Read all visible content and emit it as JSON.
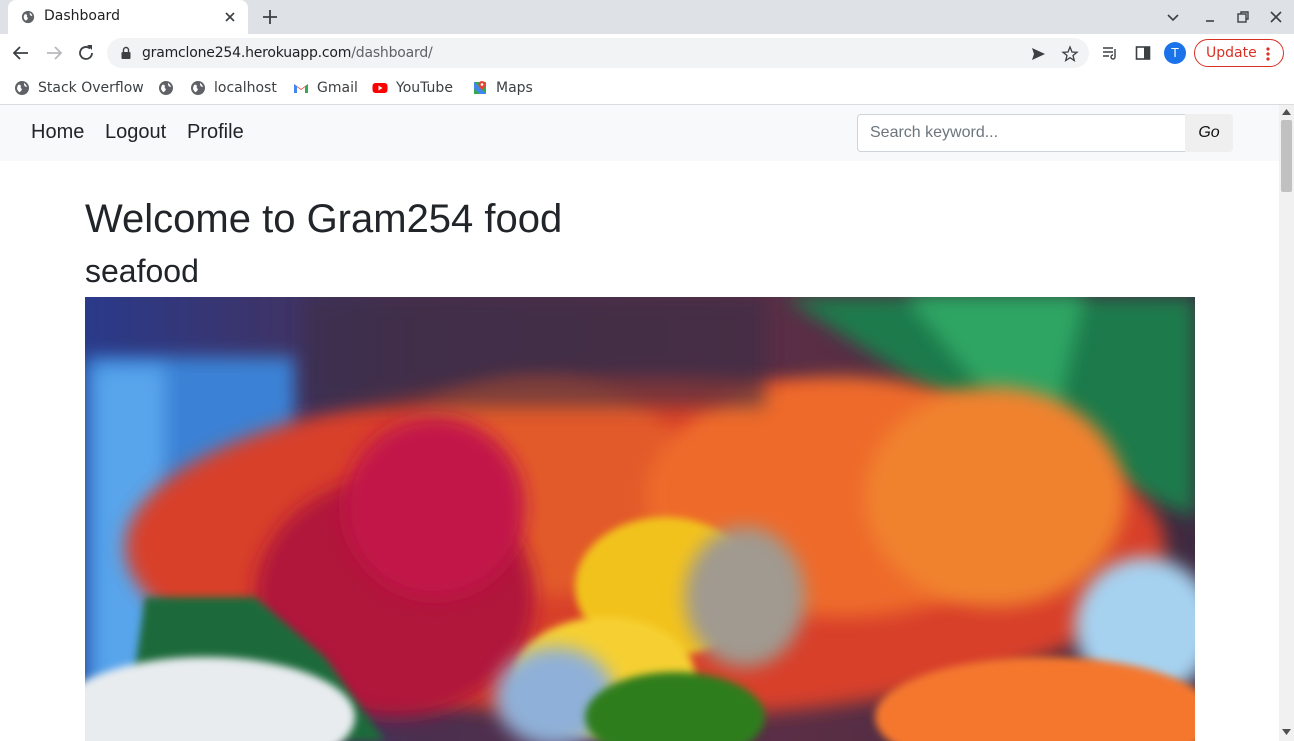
{
  "browser": {
    "tab": {
      "title": "Dashboard",
      "favicon": "globe-icon"
    },
    "url": {
      "host": "gramclone254.herokuapp.com",
      "path": "/dashboard/"
    },
    "profile_initial": "T",
    "update_label": "Update",
    "bookmarks": [
      {
        "label": "Stack Overflow",
        "icon": "globe-icon"
      },
      {
        "label": "",
        "icon": "globe-icon"
      },
      {
        "label": "localhost",
        "icon": "globe-icon"
      },
      {
        "label": "Gmail",
        "icon": "gmail-icon"
      },
      {
        "label": "YouTube",
        "icon": "youtube-icon"
      },
      {
        "label": "Maps",
        "icon": "maps-icon"
      }
    ],
    "colors": {
      "tabstrip": "#dee1e6",
      "accent": "#1a73e8",
      "update": "#d93025"
    }
  },
  "site": {
    "nav": {
      "home": "Home",
      "logout": "Logout",
      "profile": "Profile"
    },
    "search": {
      "placeholder": "Search keyword...",
      "button": "Go"
    },
    "welcome": "Welcome to Gram254 food",
    "category": "seafood",
    "image_subject": "seafood platter photo"
  }
}
